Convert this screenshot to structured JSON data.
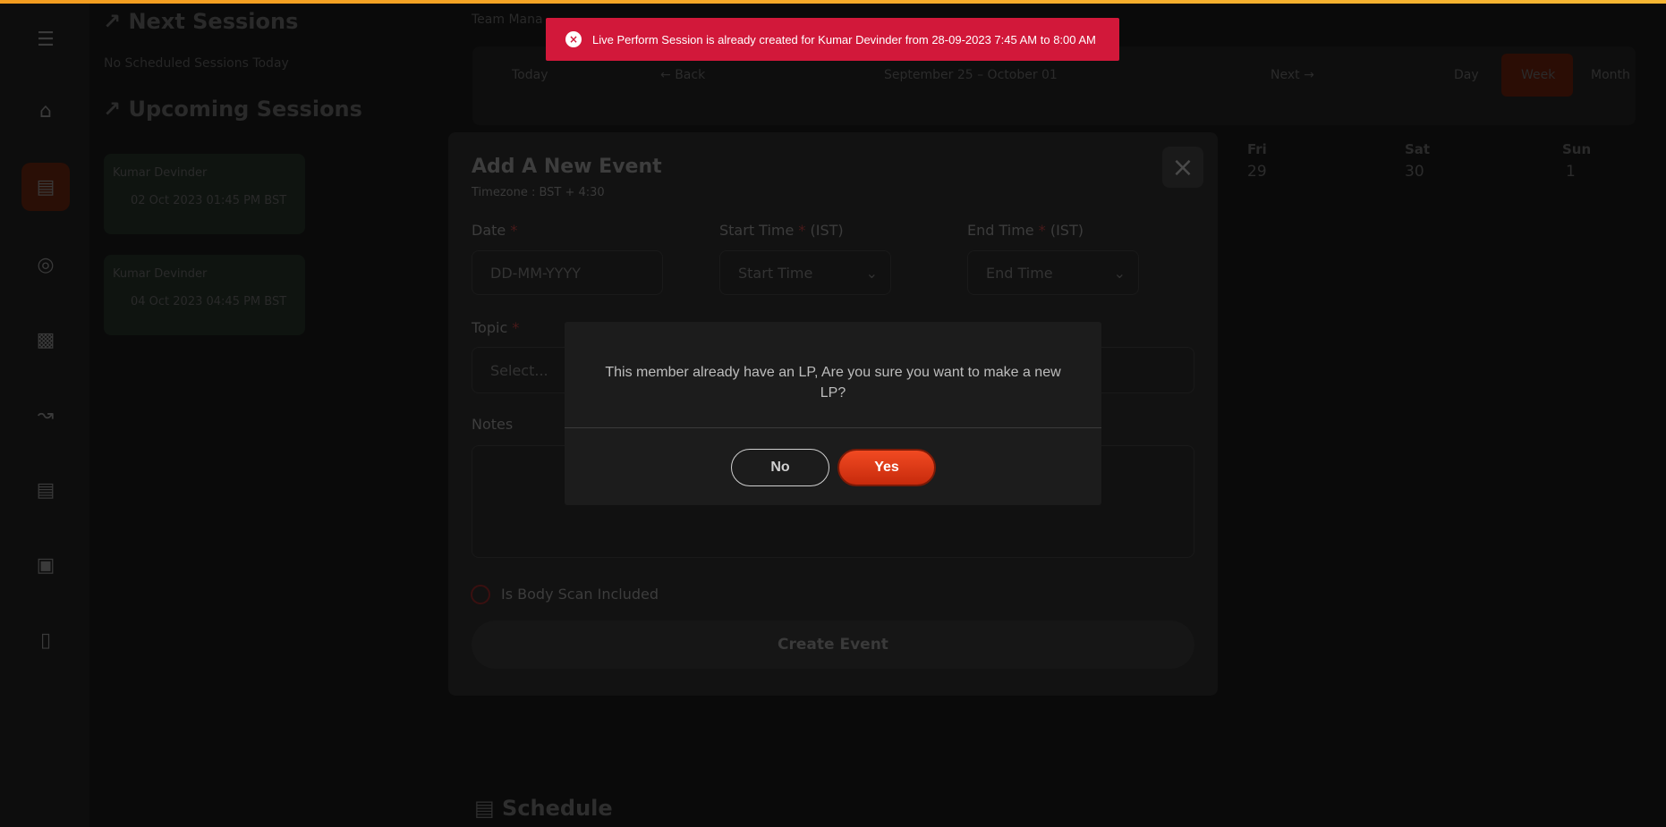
{
  "toast": {
    "message": "Live Perform Session is already created for Kumar Devinder from 28-09-2023 7:45 AM to 8:00 AM",
    "icon": "error-circle-icon",
    "color": "#d2183a"
  },
  "sessions": {
    "next_title": "Next Sessions",
    "next_empty": "No Scheduled Sessions Today",
    "upcoming_title": "Upcoming Sessions",
    "upcoming": [
      {
        "name": "Kumar Devinder",
        "date": "02 Oct 2023 01:45 PM BST"
      },
      {
        "name": "Kumar Devinder",
        "date": "04 Oct 2023 04:45 PM BST"
      }
    ]
  },
  "calendar": {
    "label": "Team Mana",
    "today": "Today",
    "back": "Back",
    "range": "September 25 – October 01",
    "next": "Next",
    "views": [
      "Day",
      "Week",
      "Month"
    ],
    "days": [
      {
        "name": "Fri",
        "num": "29"
      },
      {
        "name": "Sat",
        "num": "30"
      },
      {
        "name": "Sun",
        "num": "1"
      }
    ]
  },
  "event_form": {
    "title": "Add A New Event",
    "timezone": "Timezone : BST + 4:30",
    "date_label": "Date",
    "date_placeholder": "DD-MM-YYYY",
    "start_label": "Start Time",
    "start_suffix": "(IST)",
    "start_placeholder": "Start Time",
    "end_label": "End Time",
    "end_suffix": "(IST)",
    "end_placeholder": "End Time",
    "topic_label": "Topic",
    "topic_placeholder": "Select...",
    "notes_label": "Notes",
    "body_scan_label": "Is Body Scan Included",
    "create_button": "Create Event",
    "required_mark": "*"
  },
  "confirm": {
    "message": "This member already have an LP, Are you sure you want to make a new LP?",
    "no_label": "No",
    "yes_label": "Yes",
    "accent": "#e63b16"
  },
  "schedule": {
    "title": "Schedule"
  }
}
